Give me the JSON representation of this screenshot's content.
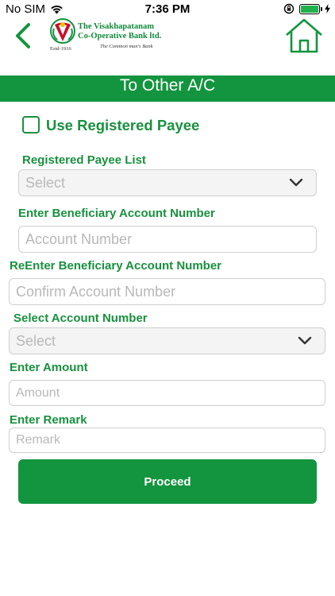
{
  "status_bar": {
    "carrier": "No SIM",
    "time": "7:36 PM",
    "battery_level": 1.0
  },
  "header": {
    "back_icon": "chevron-left-icon",
    "home_icon": "home-icon",
    "logo": {
      "line1": "The Visakhapatanam",
      "line2": "Co-Operative Bank ltd.",
      "tagline": "The Common man's Bank",
      "established": "Estd-1916"
    }
  },
  "page": {
    "title": "To Other A/C"
  },
  "form": {
    "use_registered_payee_label": "Use Registered Payee",
    "use_registered_payee_checked": false,
    "registered_payee_list": {
      "label": "Registered Payee List",
      "selected": "Select"
    },
    "account_number": {
      "label": "Enter Beneficiary Account Number",
      "placeholder": "Account Number",
      "value": ""
    },
    "confirm_account_number": {
      "label": "ReEnter Beneficiary Account Number",
      "placeholder": "Confirm Account Number",
      "value": ""
    },
    "from_account": {
      "label": "Select Account Number",
      "selected": "Select"
    },
    "amount": {
      "label": "Enter Amount",
      "placeholder": "Amount",
      "value": ""
    },
    "remark": {
      "label": "Enter Remark",
      "placeholder": "Remark",
      "value": ""
    },
    "proceed_label": "Proceed"
  },
  "colors": {
    "primary_green": "#13943e",
    "label_green": "#18913e",
    "placeholder_gray": "#b8b8b8"
  }
}
